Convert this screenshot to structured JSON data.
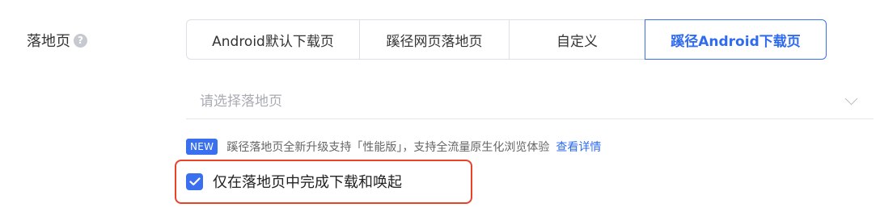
{
  "field": {
    "label": "落地页",
    "help_icon": "question-circle-icon"
  },
  "landing_type": {
    "options": [
      "Android默认下载页",
      "蹊径网页落地页",
      "自定义",
      "蹊径Android下载页"
    ],
    "selected": "蹊径Android下载页"
  },
  "select": {
    "placeholder": "请选择落地页",
    "chevron_icon": "chevron-down-icon"
  },
  "notice": {
    "badge": "NEW",
    "text": "蹊径落地页全新升级支持「性能版」，支持全流量原生化浏览体验",
    "link": "查看详情"
  },
  "checkbox": {
    "label": "仅在落地页中完成下载和唤起",
    "checked": true
  },
  "colors": {
    "accent": "#3a6ff0",
    "highlight_border": "#e8412c"
  }
}
